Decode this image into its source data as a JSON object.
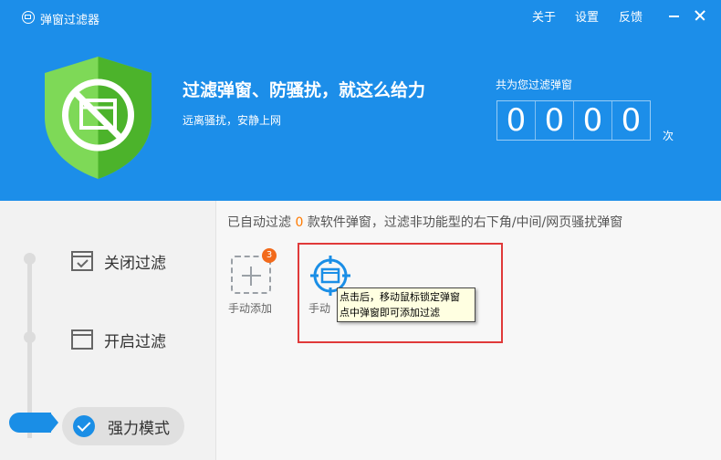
{
  "window": {
    "title": "弹窗过滤器",
    "menu": {
      "about": "关于",
      "settings": "设置",
      "feedback": "反馈"
    },
    "controls": {
      "minimize": "minimize-icon",
      "close": "close-icon"
    }
  },
  "header": {
    "slogan": "过滤弹窗、防骚扰，就这么给力",
    "subslogan": "远离骚扰，安静上网",
    "counter_label": "共为您过滤弹窗",
    "digits": [
      "0",
      "0",
      "0",
      "0"
    ],
    "counter_unit": "次"
  },
  "modes": [
    {
      "label": "关闭过滤",
      "icon": "checkbox-window-icon",
      "selected": false
    },
    {
      "label": "开启过滤",
      "icon": "window-icon",
      "selected": false
    },
    {
      "label": "强力模式",
      "icon": "check-circle-icon",
      "selected": true
    }
  ],
  "main": {
    "info_prefix": "已自动过滤 ",
    "info_count": "0",
    "info_suffix": " 款软件弹窗，过滤非功能型的右下角/中间/网页骚扰弹窗",
    "add_badge": "3",
    "add_label": "手动添加",
    "manual_label": "手动",
    "tooltip_line1": "点击后，移动鼠标锁定弹窗",
    "tooltip_line2": "点中弹窗即可添加过滤"
  },
  "colors": {
    "header": "#1c8ee9",
    "accent": "#1a8ee6",
    "shield_green": "#5cc23a",
    "count_orange": "#ff7a00",
    "badge": "#f26a1b",
    "highlight": "#e03a3a"
  }
}
